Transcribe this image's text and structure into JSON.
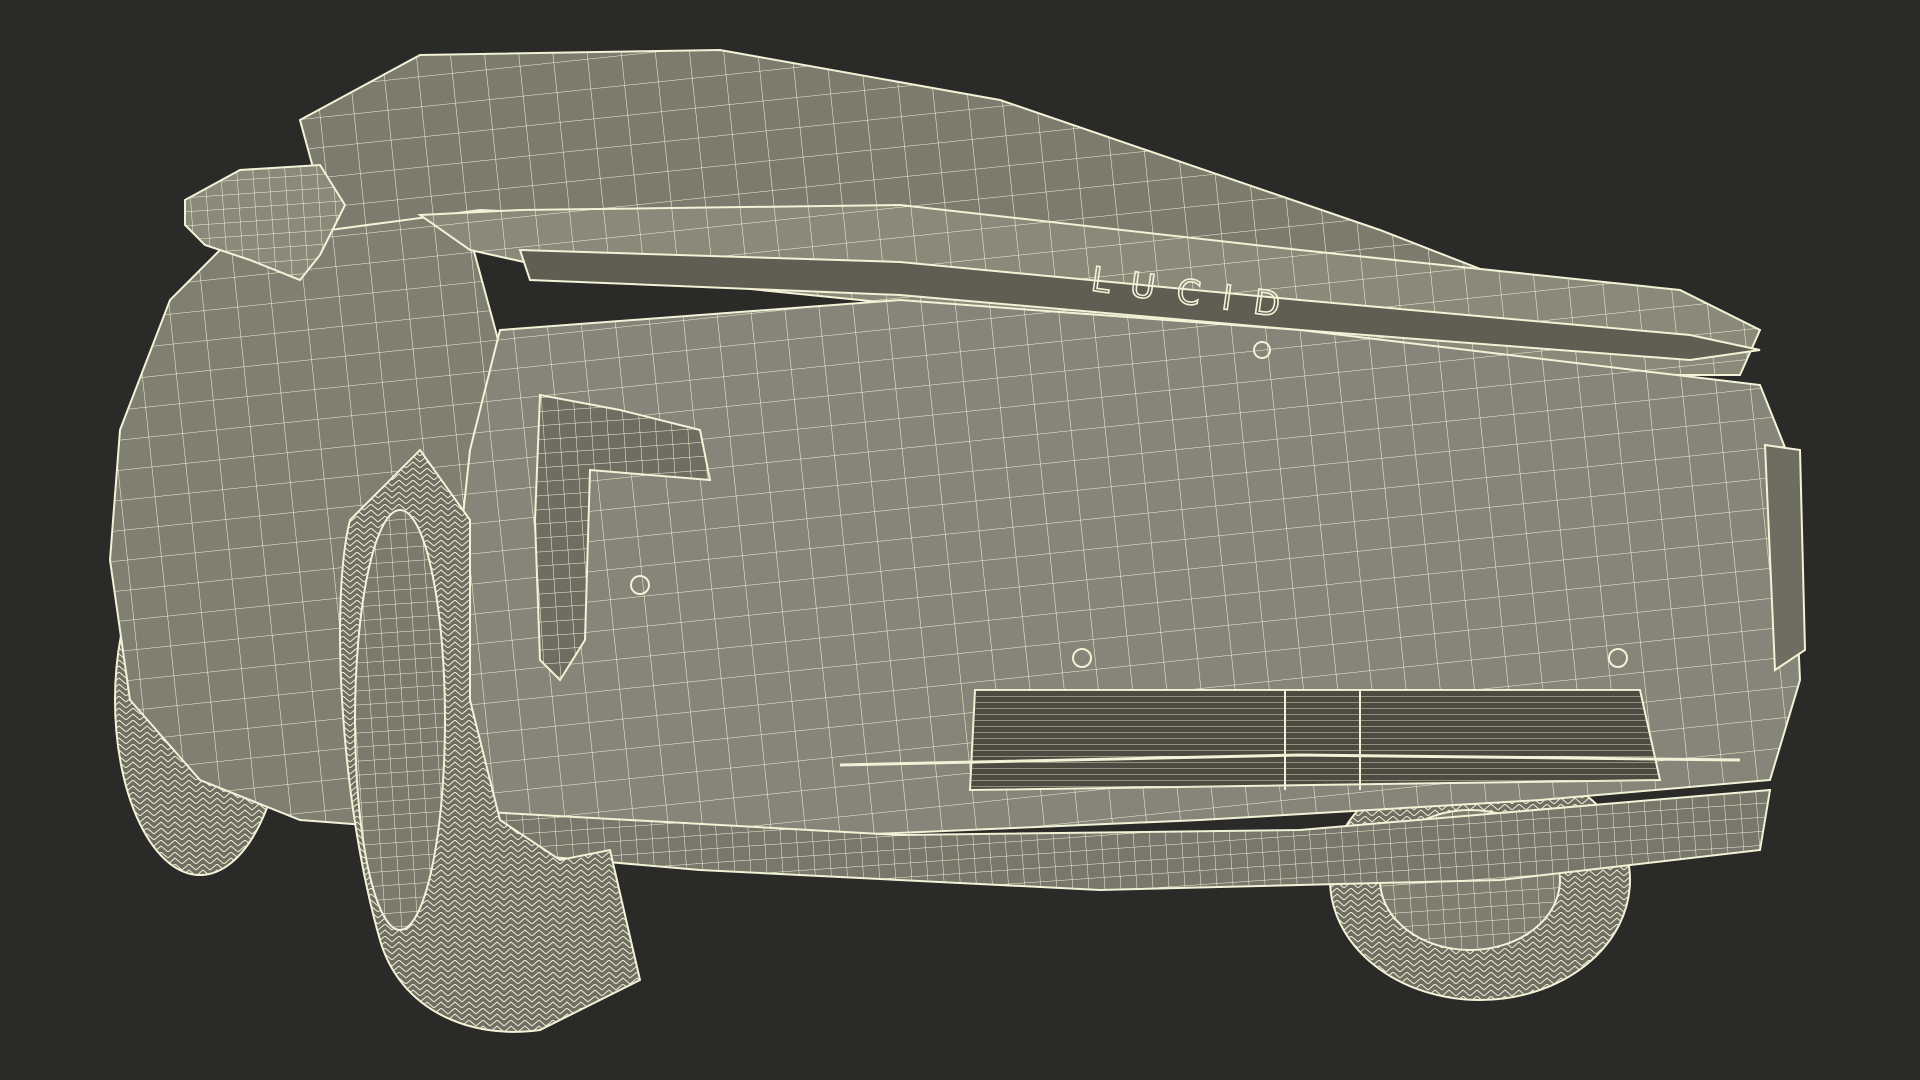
{
  "scene": {
    "subject": "car-wireframe-render",
    "badge_text": "LUCID",
    "colors": {
      "background": "#2a2a29",
      "body_fill": "#8a8a7b",
      "body_shade": "#6f6f63",
      "body_dark": "#55554b",
      "wire": "#f3f1d6",
      "grille": "#4b4b42"
    }
  }
}
